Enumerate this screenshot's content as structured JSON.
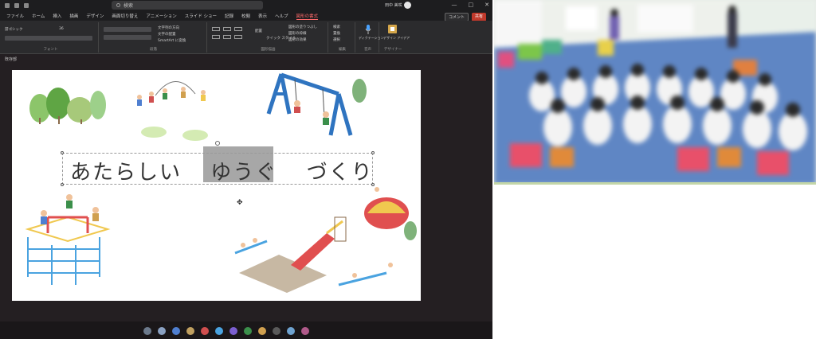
{
  "app": {
    "search_placeholder": "検索",
    "user_name": "田中 美咲",
    "window_controls": [
      "—",
      "□",
      "✕"
    ],
    "tabs": [
      {
        "label": "ファイル"
      },
      {
        "label": "ホーム"
      },
      {
        "label": "挿入"
      },
      {
        "label": "描画"
      },
      {
        "label": "デザイン"
      },
      {
        "label": "画面切り替え"
      },
      {
        "label": "アニメーション"
      },
      {
        "label": "スライド ショー"
      },
      {
        "label": "記録"
      },
      {
        "label": "校閲"
      },
      {
        "label": "表示"
      },
      {
        "label": "ヘルプ"
      },
      {
        "label": "図形の書式",
        "active": true
      }
    ],
    "comment_button": "コメント",
    "share_button": "共有",
    "ribbon": {
      "font_name": "游ゴシック",
      "font_size": "36",
      "groups": [
        {
          "label": "フォント"
        },
        {
          "label": "段落"
        },
        {
          "label": "図形描画"
        },
        {
          "label": "編集"
        },
        {
          "label": "音声"
        },
        {
          "label": "デザイナー"
        }
      ],
      "paragraph_items": [
        "文字列の方向",
        "文字の配置",
        "SmartArt に変換"
      ],
      "drawing_items": [
        "配置",
        "クイック スタイル",
        "図形の塗りつぶし",
        "図形の枠線",
        "図形の効果"
      ],
      "edit_items": [
        "検索",
        "置換",
        "選択"
      ],
      "voice_label": "ディクテーション",
      "designer_label": "デザイン アイデア"
    },
    "pane_label": "既存部",
    "slide": {
      "title_parts": [
        "あたらしい",
        "ゆうぐ",
        "づくり"
      ]
    }
  },
  "colors": {
    "accent_tab": "#ff6b6b",
    "share_button": "#c0392b",
    "selection": "#a7a7a7"
  },
  "icons": [
    "search-icon",
    "mic-icon",
    "designer-icon",
    "swing-icon",
    "tree-icon",
    "jungle-gym-icon",
    "slide-icon",
    "cursor-icon"
  ]
}
